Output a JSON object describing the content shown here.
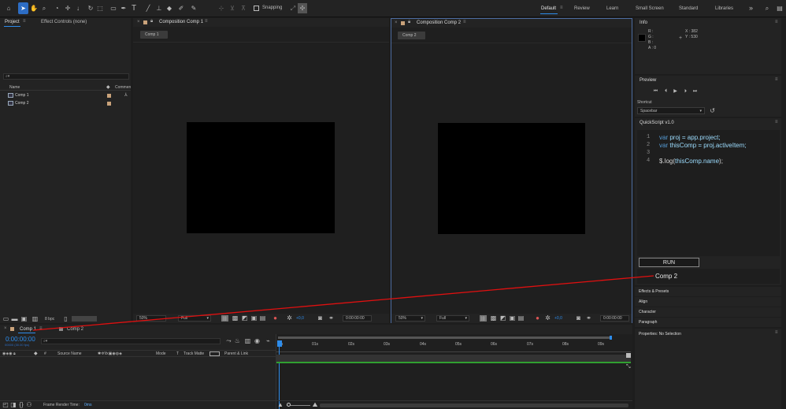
{
  "toolbar": {
    "snapping_label": "Snapping",
    "workspaces": [
      "Default",
      "Review",
      "Learn",
      "Small Screen",
      "Standard",
      "Libraries"
    ],
    "more_glyph": "»"
  },
  "project_panel": {
    "tab_project": "Project",
    "tab_effect_controls": "Effect Controls (none)",
    "search_glyph": "⌕▾",
    "col_name": "Name",
    "col_comment": "Commen",
    "items": [
      "Comp 1",
      "Comp 2"
    ],
    "bpc": "8 bpc"
  },
  "viewer1": {
    "tab_label": "Composition Comp 1",
    "chip": "Comp 1",
    "zoom": "50%",
    "resolution": "Full",
    "exposure": "+0,0",
    "timecode": "0:00:00:00"
  },
  "viewer2": {
    "tab_label": "Composition Comp 2",
    "chip": "Comp 2",
    "zoom": "50%",
    "resolution": "Full",
    "exposure": "+0,0",
    "timecode": "0:00:00:00"
  },
  "info_panel": {
    "title": "Info",
    "r": "R :",
    "g": "G :",
    "b": "B :",
    "a": "A :  0",
    "x": "X : 382",
    "y": "Y : 530"
  },
  "preview_panel": {
    "title": "Preview",
    "shortcut_label": "Shortcut",
    "shortcut_value": "Spacebar"
  },
  "quickscript": {
    "title": "QuickScript v1.0",
    "line_numbers": [
      "1",
      "2",
      "3",
      "4"
    ],
    "lines": [
      [
        "var",
        " proj = app.project;"
      ],
      [
        "var",
        " thisComp = proj.activeItem;"
      ],
      [
        "",
        ""
      ],
      [
        "$.log(",
        "thisComp.name",
        ");"
      ]
    ],
    "run_label": "RUN",
    "output": "Comp 2"
  },
  "side_panels": [
    "Effects & Presets",
    "Align",
    "Character",
    "Paragraph",
    "Properties: No Selection"
  ],
  "timeline": {
    "tab_comp1": "Comp 1",
    "tab_comp2": "Comp 2",
    "timecode": "0:00:00:00",
    "fps": "00000 (30.00 fps)",
    "col_source": "Source Name",
    "col_mode": "Mode",
    "col_t": "T",
    "col_trackmatte": "Track Matte",
    "col_parent": "Parent & Link",
    "ruler": [
      "0s",
      "01s",
      "02s",
      "03s",
      "04s",
      "05s",
      "06s",
      "07s",
      "08s",
      "09s"
    ],
    "frame_render_label": "Frame Render Time:",
    "frame_render_value": "0ms"
  },
  "colors": {
    "accent_blue": "#2d8ceb",
    "annotation_red": "#e01010",
    "code_keyword": "#569cd6",
    "code_ident": "#9cdcfe",
    "code_text": "#d4d4d4",
    "label_tan": "#c9a27a",
    "work_area_green": "#30a030"
  }
}
